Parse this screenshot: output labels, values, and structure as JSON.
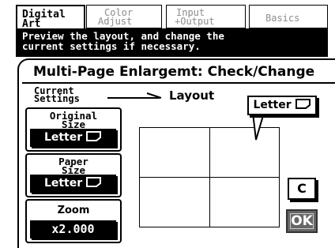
{
  "tabs": [
    {
      "line1": "Digital",
      "line2": "Art",
      "active": true
    },
    {
      "line1": "Color",
      "line2": "Adjust",
      "active": false
    },
    {
      "line1": "Input",
      "line2": "+Output",
      "active": false
    },
    {
      "line1": "Basics",
      "line2": "",
      "active": false
    }
  ],
  "message": {
    "line1": "Preview the layout, and change the",
    "line2": "current settings if necessary."
  },
  "panel_title": "Multi-Page Enlargemt: Check/Change",
  "current_settings": {
    "line1": "Current",
    "line2": "Settings"
  },
  "layout_label": "Layout",
  "settings": {
    "original_size": {
      "label1": "Original",
      "label2": "Size",
      "value": "Letter"
    },
    "paper_size": {
      "label1": "Paper",
      "label2": "Size",
      "value": "Letter"
    },
    "zoom": {
      "label": "Zoom",
      "value": "x2.000"
    }
  },
  "preview_paper": "Letter",
  "layout_grid": {
    "columns": 2,
    "rows": 2
  },
  "buttons": {
    "clear": "C",
    "ok": "OK"
  }
}
